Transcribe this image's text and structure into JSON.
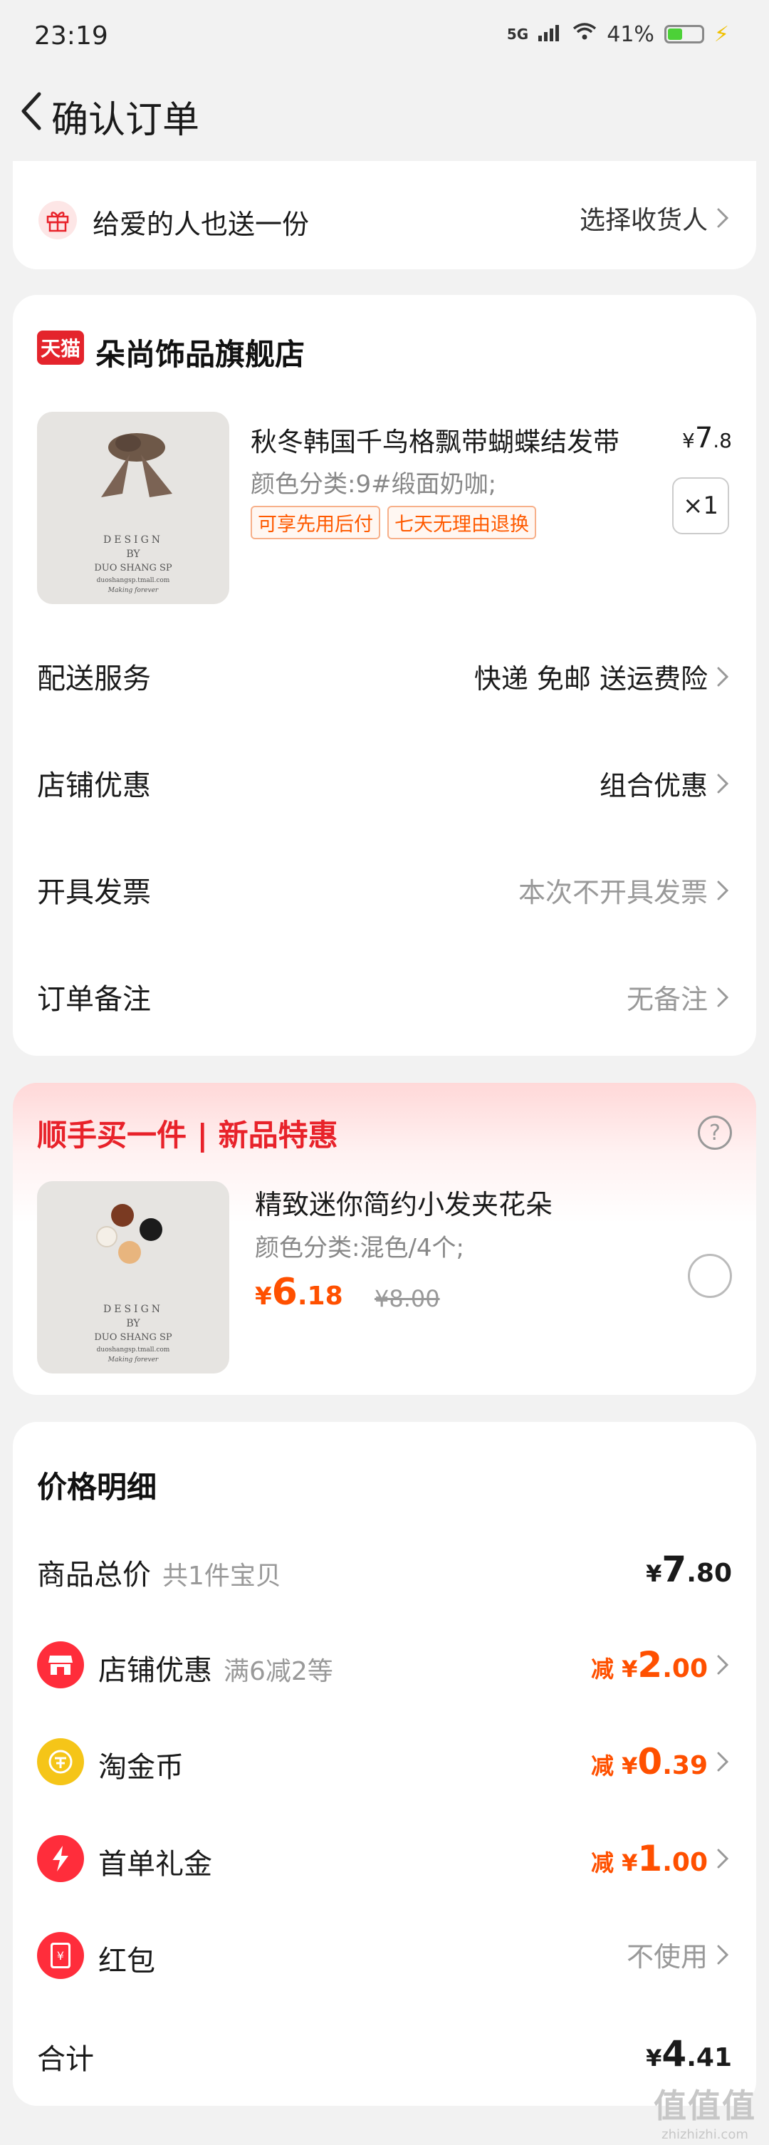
{
  "status": {
    "time": "23:19",
    "network": "5G",
    "battery": "41%",
    "battery_level": 0.41
  },
  "header": {
    "title": "确认订单"
  },
  "gift": {
    "label": "给爱的人也送一份",
    "action": "选择收货人"
  },
  "shop": {
    "name": "朵尚饰品旗舰店",
    "logo_text": "天猫",
    "product": {
      "title": "秋冬韩国千鸟格飘带蝴蝶结发带",
      "price_symbol": "¥",
      "price_int": "7",
      "price_dec": ".8",
      "sku": "颜色分类:9#缎面奶咖;",
      "tags": [
        "可享先用后付",
        "七天无理由退换"
      ],
      "qty": "×1",
      "thumb_lines": [
        "DESIGN",
        "BY",
        "DUO SHANG SP",
        "duoshangsp.tmall.com",
        "Making forever"
      ]
    },
    "rows": [
      {
        "label": "配送服务",
        "value": "快递 免邮 送运费险"
      },
      {
        "label": "店铺优惠",
        "value": "组合优惠"
      },
      {
        "label": "开具发票",
        "value": "本次不开具发票"
      },
      {
        "label": "订单备注",
        "value": "无备注"
      }
    ]
  },
  "promo": {
    "title": "顺手买一件 | 新品特惠",
    "product_title": "精致迷你简约小发夹花朵",
    "sku": "颜色分类:混色/4个;",
    "price_symbol": "¥",
    "price_int": "6",
    "price_dec": ".18",
    "orig_price": "¥8.00",
    "help": "?"
  },
  "price_detail": {
    "heading": "价格明细",
    "goods_total": {
      "label": "商品总价",
      "sub": "共1件宝贝",
      "cur": "¥",
      "int": "7",
      "dec": ".80"
    },
    "shop_discount": {
      "label": "店铺优惠",
      "sub": "满6减2等",
      "pre": "减 ¥",
      "int": "2",
      "dec": ".00"
    },
    "coins": {
      "label": "淘金币",
      "pre": "减 ¥",
      "int": "0",
      "dec": ".39"
    },
    "first_gift": {
      "label": "首单礼金",
      "pre": "减 ¥",
      "int": "1",
      "dec": ".00"
    },
    "red_packet": {
      "label": "红包",
      "value": "不使用",
      "icon_glyph": "¥"
    },
    "total": {
      "label": "合计",
      "cur": "¥",
      "int": "4",
      "dec": ".41"
    }
  },
  "watermark": {
    "big": "值值值",
    "small": "zhizhizhi.com"
  },
  "colors": {
    "accent": "#ff5000",
    "brand_red": "#e8222a",
    "tmall_red": "#e4242c",
    "coin": "#f5c518"
  }
}
